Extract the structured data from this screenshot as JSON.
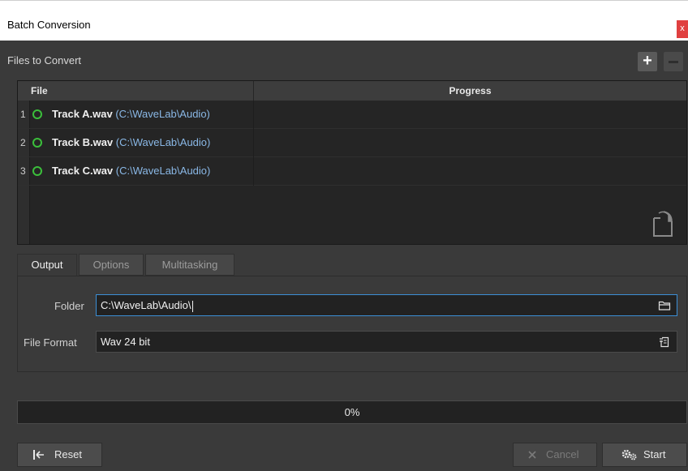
{
  "window": {
    "title": "Batch Conversion",
    "close_glyph": "x"
  },
  "files_section": {
    "label": "Files to Convert",
    "add_glyph": "+",
    "columns": {
      "file": "File",
      "progress": "Progress"
    },
    "rows": [
      {
        "num": "1",
        "name": "Track A.wav",
        "path": "(C:\\WaveLab\\Audio)"
      },
      {
        "num": "2",
        "name": "Track B.wav",
        "path": "(C:\\WaveLab\\Audio)"
      },
      {
        "num": "3",
        "name": "Track C.wav",
        "path": "(C:\\WaveLab\\Audio)"
      }
    ],
    "status_color": "#3bbf3b",
    "path_color": "#8ab8e6"
  },
  "tabs": [
    "Output",
    "Options",
    "Multitasking"
  ],
  "active_tab": "Output",
  "output": {
    "folder_label": "Folder",
    "folder_value": "C:\\WaveLab\\Audio\\",
    "format_label": "File Format",
    "format_value": "Wav 24 bit"
  },
  "progress": {
    "text": "0%",
    "value": 0
  },
  "buttons": {
    "reset": {
      "label": "Reset",
      "icon": "reset-icon"
    },
    "cancel": {
      "label": "Cancel",
      "icon": "close-icon",
      "enabled": false
    },
    "start": {
      "label": "Start",
      "icon": "gears-icon"
    }
  },
  "colors": {
    "accent": "#3c8fd6",
    "close": "#e04040"
  }
}
